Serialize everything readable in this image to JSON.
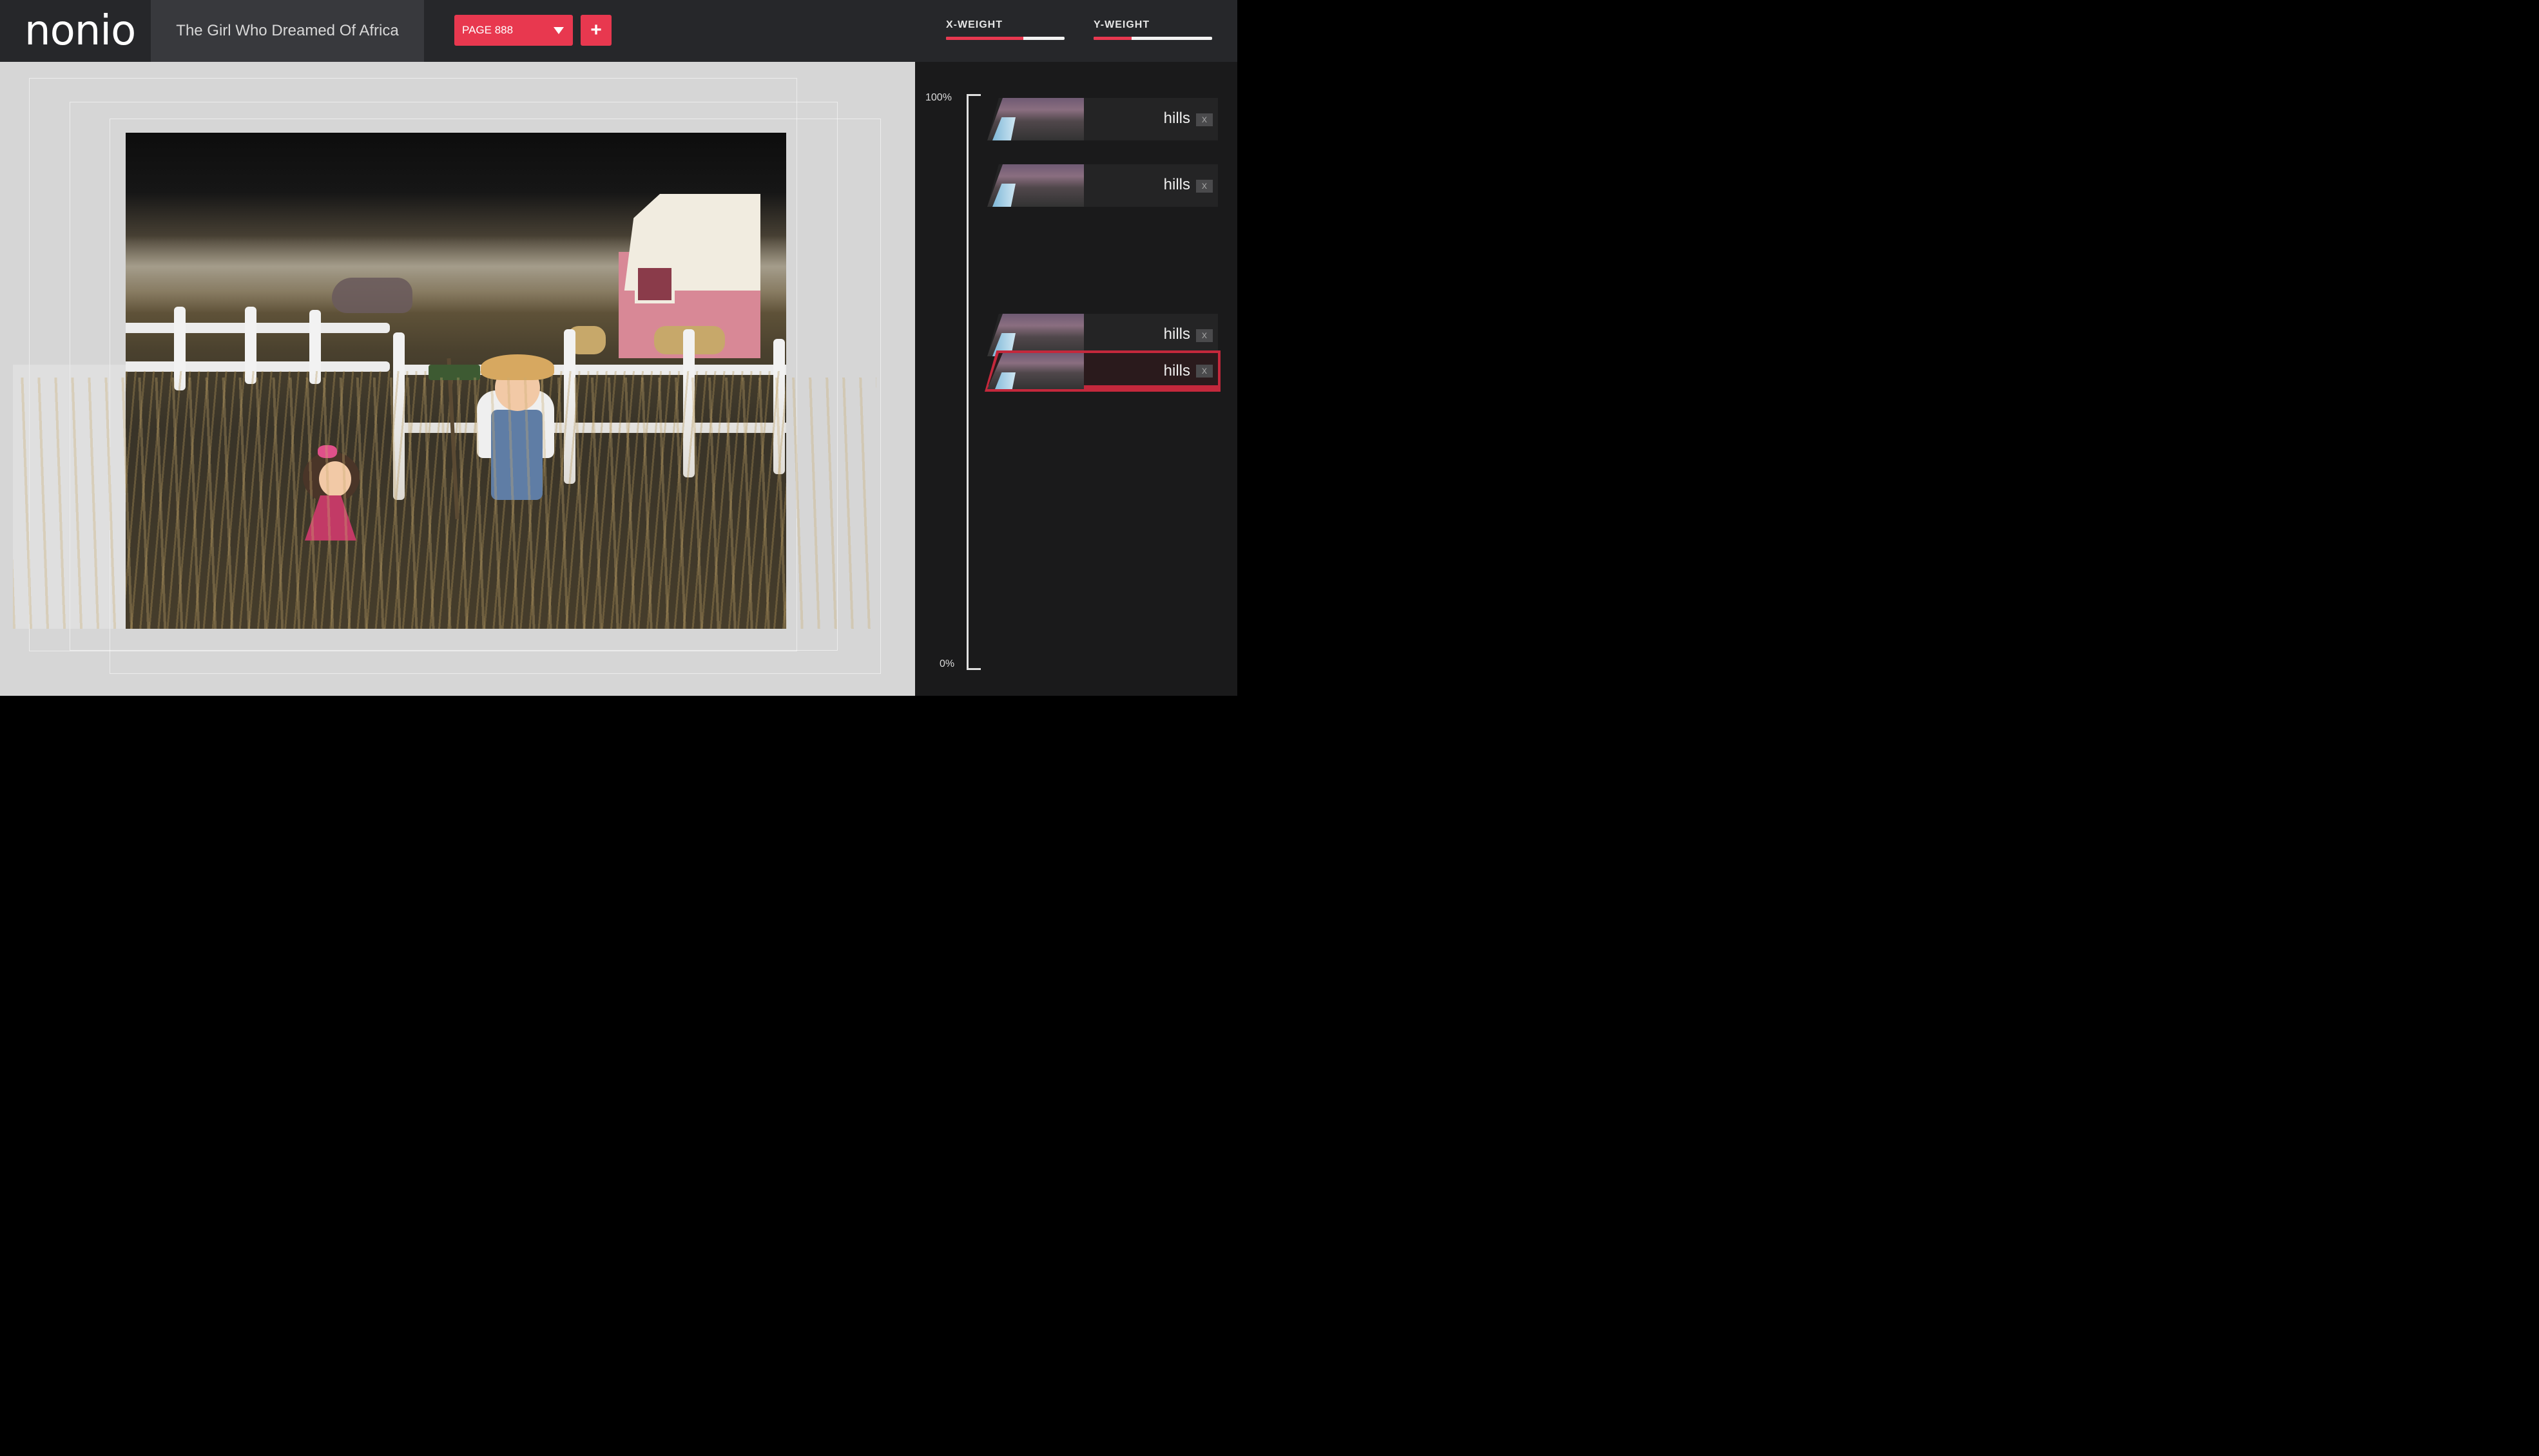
{
  "header": {
    "logo": "nonio",
    "book_title": "The Girl Who Dreamed Of Africa",
    "page_select": "PAGE 888",
    "add_label": "+"
  },
  "panel": {
    "x_weight": {
      "label": "X-WEIGHT",
      "value": 0.65
    },
    "y_weight": {
      "label": "Y-WEIGHT",
      "value": 0.32
    },
    "scale_top": "100%",
    "scale_bottom": "0%",
    "layers": [
      {
        "name": "hills",
        "close": "x",
        "selected": false
      },
      {
        "name": "hills",
        "close": "x",
        "selected": false
      },
      {
        "name": "hills",
        "close": "x",
        "selected": false
      },
      {
        "name": "hills",
        "close": "x",
        "selected": true
      }
    ]
  },
  "colors": {
    "accent": "#e8384f",
    "topbar": "#26272a",
    "panel": "#1a1a1b",
    "canvas": "#d6d6d6"
  }
}
